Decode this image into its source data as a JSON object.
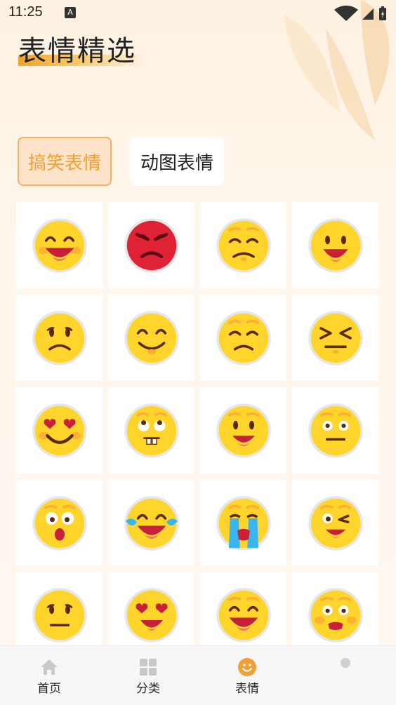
{
  "status_bar": {
    "time": "11:25",
    "notification_icon": "a-icon"
  },
  "header": {
    "title": "表情精选"
  },
  "tabs": [
    {
      "label": "搞笑表情",
      "active": true
    },
    {
      "label": "动图表情",
      "active": false
    }
  ],
  "emojis": [
    "grinning-blush",
    "angry-red",
    "unamused",
    "happy-open-mouth",
    "frowning",
    "content-smile",
    "sad-squint",
    "tightly-closed-eyes",
    "heart-eyes-smile",
    "rolling-eyes-teeth",
    "raised-brow-smile",
    "neutral-wide-eyes",
    "astonished",
    "tears-of-joy",
    "loudly-crying",
    "winking",
    "neutral-face",
    "heart-eyes-open",
    "grinning-raised-brows",
    "blushing-worried"
  ],
  "nav": [
    {
      "label": "首页",
      "icon": "home-icon",
      "active": false
    },
    {
      "label": "分类",
      "icon": "grid-icon",
      "active": false
    },
    {
      "label": "表情",
      "icon": "smiley-icon",
      "active": true
    },
    {
      "label": "",
      "icon": "dot-icon",
      "active": false
    }
  ],
  "colors": {
    "accent": "#f1a035",
    "emoji_yellow": "#ffd52b",
    "angry_red": "#e02236",
    "background": "#fdf1e1"
  }
}
